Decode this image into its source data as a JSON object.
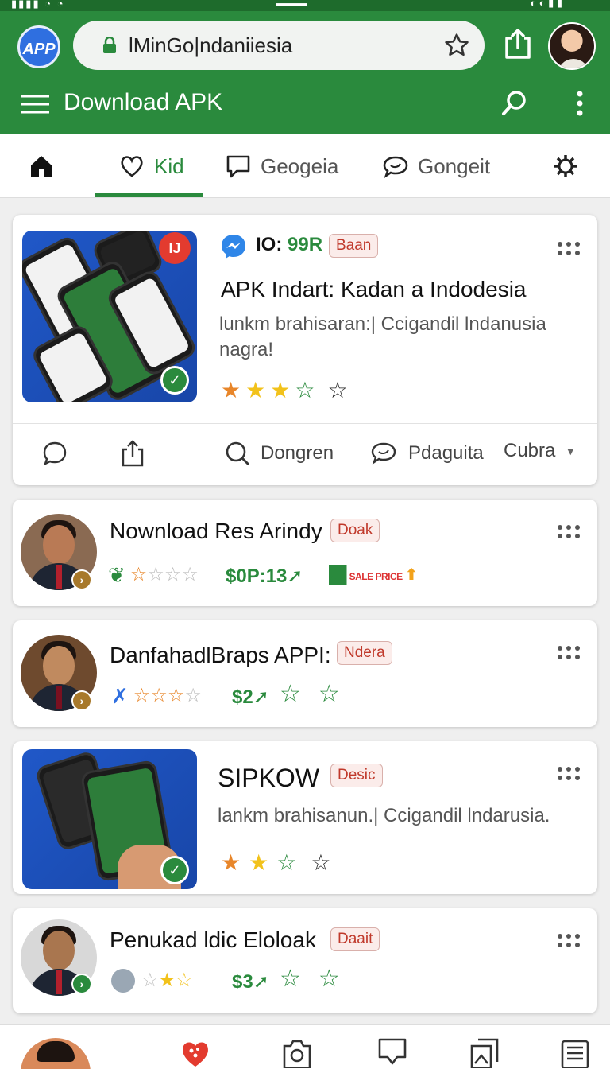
{
  "browser": {
    "logo_text": "APP",
    "url": "lMinGo|ndaniiesia"
  },
  "header": {
    "title": "Download APK"
  },
  "tabs": [
    {
      "label": ""
    },
    {
      "label": "Kid"
    },
    {
      "label": "Geogeia"
    },
    {
      "label": "Gongeit"
    },
    {
      "label": ""
    }
  ],
  "cards": [
    {
      "meta": "IO: 99R",
      "tag": "Baan",
      "title": "APK Indart: Kadan a Indodesia",
      "desc": "lunkm brahisaran:| Ccigandil lndanusia nagra!",
      "rating_text": "",
      "actions": {
        "search_label": "Dongren",
        "chat_label": "Pdaguita",
        "filter_label": "Cubra"
      }
    },
    {
      "title": "Nownload Res Arindy",
      "tag": "Doak",
      "price": "$0P:13",
      "extra": "SALE PRICE"
    },
    {
      "title": "DanfahadlBraps APPI:",
      "tag": "Ndera",
      "price": "$2"
    },
    {
      "title": "SIPKOW",
      "tag": "Desic",
      "desc": "lankm brahisanun.| Ccigandil lndarusia."
    },
    {
      "title": "Penukad ldic Eloloak",
      "tag": "Daait",
      "price": "$3"
    }
  ],
  "colors": {
    "brand_green": "#2a8a3d",
    "tag_red": "#c0392b",
    "star_orange": "#e8862a",
    "star_yellow": "#f2c21b"
  }
}
